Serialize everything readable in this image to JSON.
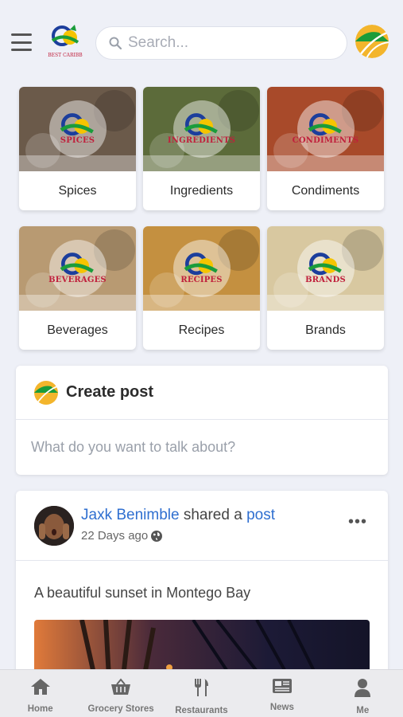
{
  "header": {
    "logo_name": "best-caribb-logo",
    "search_placeholder": "Search..."
  },
  "categories": [
    {
      "label": "Spices",
      "badge": "SPICES",
      "bg": "#6b5a4a"
    },
    {
      "label": "Ingredients",
      "badge": "INGREDIENTS",
      "bg": "#5c6b3a"
    },
    {
      "label": "Condiments",
      "badge": "CONDIMENTS",
      "bg": "#a84a2a"
    },
    {
      "label": "Beverages",
      "badge": "BEVERAGES",
      "bg": "#b89a72"
    },
    {
      "label": "Recipes",
      "badge": "RECIPES",
      "bg": "#c49040"
    },
    {
      "label": "Brands",
      "badge": "BRANDS",
      "bg": "#d8c8a0"
    }
  ],
  "create_post": {
    "title": "Create post",
    "placeholder": "What do you want to talk about?"
  },
  "post": {
    "author": "Jaxk Benimble",
    "action_text": "shared a",
    "action_link": "post",
    "time": "22 Days ago",
    "visibility_icon": "globe-icon",
    "text": "A beautiful sunset in Montego Bay"
  },
  "bottom_nav": [
    {
      "label": "Home",
      "icon": "home-icon"
    },
    {
      "label": "Grocery Stores",
      "icon": "basket-icon"
    },
    {
      "label": "Restaurants",
      "icon": "utensils-icon"
    },
    {
      "label": "News",
      "icon": "newspaper-icon"
    },
    {
      "label": "Me",
      "icon": "user-icon"
    }
  ],
  "colors": {
    "accent_link": "#2f6fd0",
    "background": "#eef0f7",
    "badge_text": "#c0203c"
  }
}
